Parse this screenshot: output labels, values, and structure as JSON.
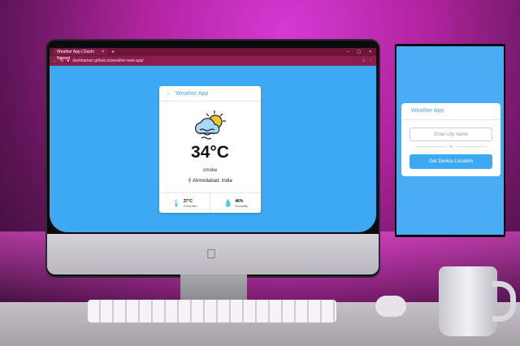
{
  "browser": {
    "tab_title": "Weather App | Dashi Named",
    "tab_close": "×",
    "new_tab": "+",
    "url": "davhitaman.github.io/weather-web-app/",
    "window_controls": [
      "–",
      "▢",
      "×"
    ]
  },
  "app": {
    "title": "Weather App",
    "back_icon": "arrow-left-icon",
    "temperature": "34°C",
    "description": "smoke",
    "location": "Ahmedabad, India",
    "feels_like_value": "37°C",
    "feels_like_label": "Feels like",
    "humidity_value": "46%",
    "humidity_label": "Humidity"
  },
  "phone_app": {
    "title": "Weather App",
    "city_placeholder": "Enter city name",
    "divider": "or",
    "location_button": "Get Device Location"
  },
  "colors": {
    "accent": "#3ea9f3",
    "browser_frame": "#6e1436"
  }
}
